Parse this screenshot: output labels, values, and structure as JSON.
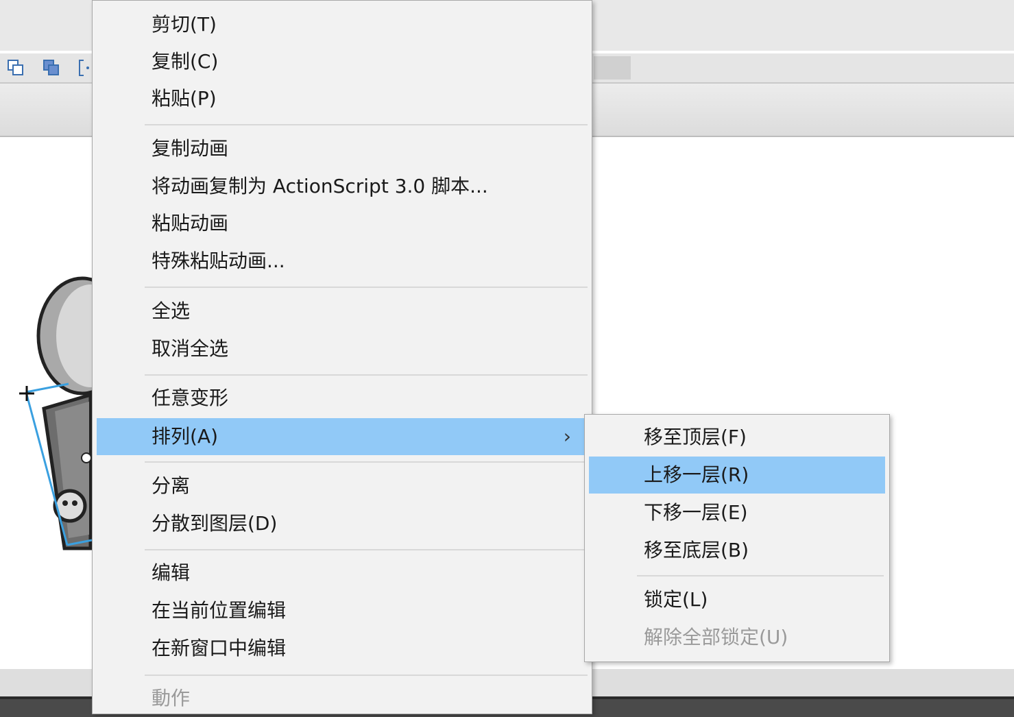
{
  "context_menu": {
    "items": [
      {
        "label": "剪切(T)"
      },
      {
        "label": "复制(C)"
      },
      {
        "label": "粘贴(P)"
      },
      {
        "label": "复制动画"
      },
      {
        "label": "将动画复制为 ActionScript 3.0 脚本..."
      },
      {
        "label": "粘贴动画"
      },
      {
        "label": "特殊粘贴动画..."
      },
      {
        "label": "全选"
      },
      {
        "label": "取消全选"
      },
      {
        "label": "任意变形"
      },
      {
        "label": "排列(A)",
        "highlighted": true,
        "has_submenu": true
      },
      {
        "label": "分离"
      },
      {
        "label": "分散到图层(D)"
      },
      {
        "label": "编辑"
      },
      {
        "label": "在当前位置编辑"
      },
      {
        "label": "在新窗口中编辑"
      },
      {
        "label": "動作",
        "disabled": true
      }
    ],
    "submenu_arrow": "chevron-right-icon"
  },
  "arrange_submenu": {
    "items": [
      {
        "label": "移至顶层(F)"
      },
      {
        "label": "上移一层(R)",
        "highlighted": true
      },
      {
        "label": "下移一层(E)"
      },
      {
        "label": "移至底层(B)"
      },
      {
        "label": "锁定(L)"
      },
      {
        "label": "解除全部锁定(U)",
        "disabled": true
      }
    ]
  },
  "toolbar": {
    "icons": [
      "bring-to-front-icon",
      "send-to-back-icon",
      "group-bracket-icon"
    ]
  },
  "colors": {
    "highlight": "#91c9f7",
    "menu_bg": "#f2f2f2",
    "disabled_text": "#9a9a9a"
  }
}
